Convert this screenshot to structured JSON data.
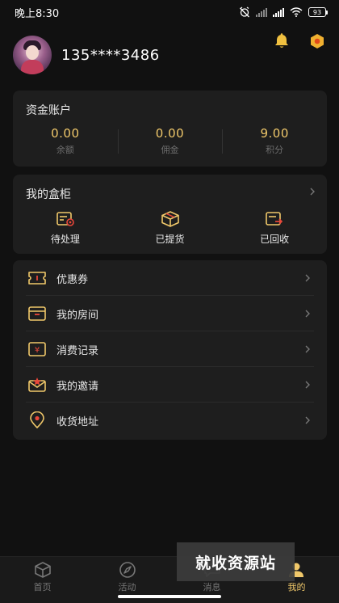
{
  "status_bar": {
    "time": "晚上8:30",
    "battery": "93"
  },
  "profile": {
    "phone": "135****3486"
  },
  "fund": {
    "title": "资金账户",
    "items": [
      {
        "value": "0.00",
        "label": "余额"
      },
      {
        "value": "0.00",
        "label": "佣金"
      },
      {
        "value": "9.00",
        "label": "积分"
      }
    ]
  },
  "box": {
    "title": "我的盒柜",
    "items": [
      {
        "label": "待处理",
        "icon": "pending-icon"
      },
      {
        "label": "已提货",
        "icon": "box-icon"
      },
      {
        "label": "已回收",
        "icon": "recycle-icon"
      }
    ]
  },
  "menu": {
    "items": [
      {
        "label": "优惠券",
        "icon": "coupon-icon"
      },
      {
        "label": "我的房间",
        "icon": "room-icon"
      },
      {
        "label": "消费记录",
        "icon": "record-icon"
      },
      {
        "label": "我的邀请",
        "icon": "invite-icon"
      },
      {
        "label": "收货地址",
        "icon": "location-icon"
      }
    ]
  },
  "bottom_nav": {
    "items": [
      {
        "label": "首页",
        "icon": "home-icon"
      },
      {
        "label": "活动",
        "icon": "compass-icon"
      },
      {
        "label": "消息",
        "icon": "message-icon"
      },
      {
        "label": "我的",
        "icon": "user-icon"
      }
    ],
    "active": "我的"
  },
  "watermark": "就收资源站",
  "colors": {
    "accent": "#f0c86a",
    "background": "#111111",
    "card": "#1e1e1e"
  }
}
